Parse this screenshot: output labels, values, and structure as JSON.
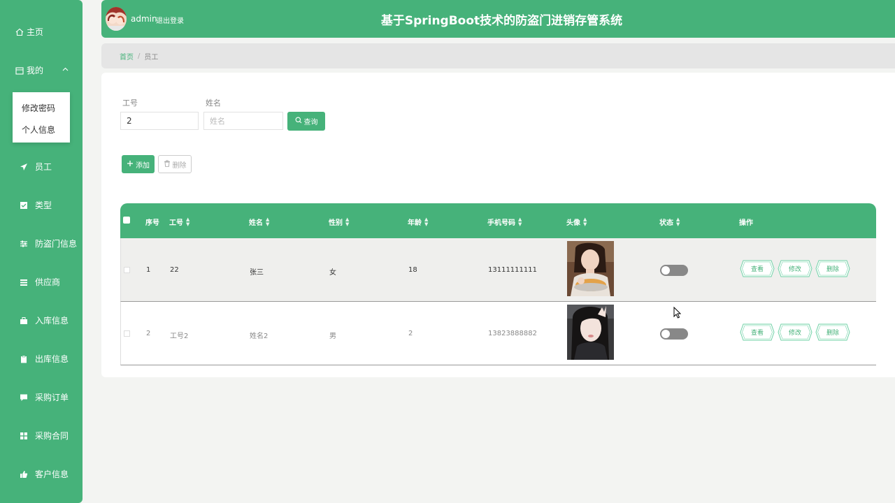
{
  "sidebar": {
    "home": "主页",
    "mine": "我的",
    "submenu": [
      "修改密码",
      "个人信息"
    ],
    "items": [
      "员工",
      "类型",
      "防盗门信息",
      "供应商",
      "入库信息",
      "出库信息",
      "采购订单",
      "采购合同",
      "客户信息"
    ]
  },
  "header": {
    "user": "admin",
    "logout": "退出登录",
    "title": "基于SpringBoot技术的防盗门进销存管系统"
  },
  "breadcrumb": {
    "home": "首页",
    "sep": "/",
    "current": "员工"
  },
  "search": {
    "label_id": "工号",
    "label_name": "姓名",
    "id_value": "2",
    "name_placeholder": "姓名",
    "search_btn": "查询"
  },
  "actions": {
    "add": "添加",
    "delete": "删除"
  },
  "table": {
    "headers": [
      "序号",
      "工号",
      "姓名",
      "性别",
      "年龄",
      "手机号码",
      "头像",
      "状态",
      "操作"
    ],
    "rows": [
      {
        "index": "1",
        "id": "22",
        "name": "张三",
        "gender": "女",
        "age": "18",
        "phone": "13111111111"
      },
      {
        "index": "2",
        "id": "工号2",
        "name": "姓名2",
        "gender": "男",
        "age": "2",
        "phone": "13823888882"
      }
    ],
    "ops": [
      "查看",
      "修改",
      "删除"
    ]
  },
  "colors": {
    "primary": "#46b27a",
    "toggle_off": "#888888"
  }
}
